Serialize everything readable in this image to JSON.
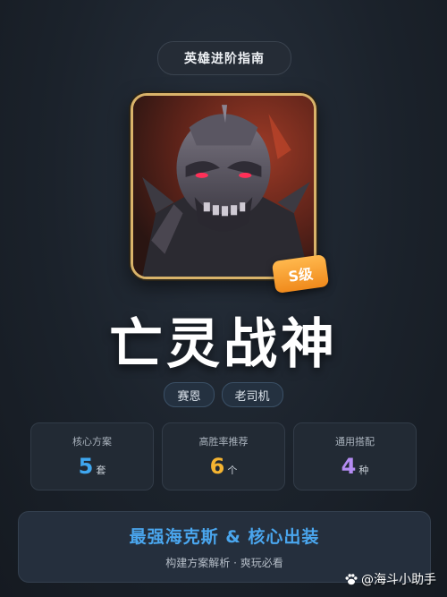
{
  "header": {
    "title": "英雄进阶指南"
  },
  "hero": {
    "name": "亡灵战神",
    "rank_badge": "S级",
    "tags": [
      "赛恩",
      "老司机"
    ]
  },
  "stats": [
    {
      "label": "核心方案",
      "value": "5",
      "unit": "套",
      "color": "#3fa7f0"
    },
    {
      "label": "高胜率推荐",
      "value": "6",
      "unit": "个",
      "color": "#f5b431"
    },
    {
      "label": "通用搭配",
      "value": "4",
      "unit": "种",
      "color": "#b48cf2"
    }
  ],
  "banner": {
    "title": "最强海克斯 & 核心出装",
    "subtitle": "构建方案解析 · 爽玩必看"
  },
  "watermark": {
    "text": "@海斗小助手",
    "icon": "paw-icon"
  },
  "colors": {
    "accent": "#4aa6ee",
    "badge": "#f08a1c",
    "frame": "#d9b36a"
  }
}
